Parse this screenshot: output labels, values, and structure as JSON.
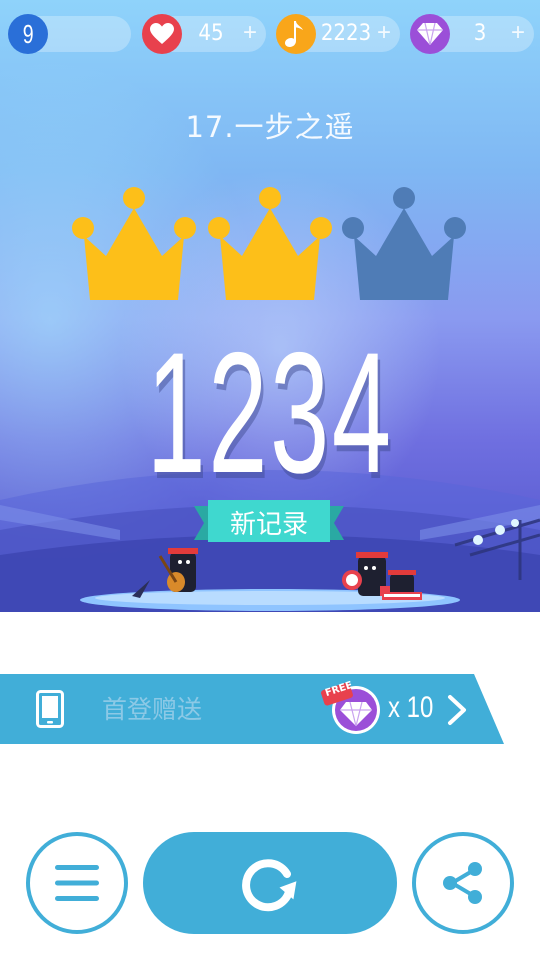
{
  "hud": {
    "level": "9",
    "lives": "45",
    "notes": "2223",
    "diamonds": "3",
    "plus": "+"
  },
  "song": {
    "title": "17.一步之遥"
  },
  "result": {
    "crowns_earned": 2,
    "crowns_total": 3,
    "score": "1234",
    "record_label": "新记录"
  },
  "promo": {
    "label": "首登赠送",
    "badge": "FREE",
    "count": "x 10"
  },
  "colors": {
    "accent": "#41aed8",
    "crown_gold": "#fdbf19",
    "crown_dim": "#4f7cb6",
    "heart": "#e8414d",
    "note": "#f9a61a",
    "diamond": "#9b4fd8",
    "level_badge": "#2a6fd8",
    "ribbon": "#3fd8cf"
  },
  "icons": [
    "heart-icon",
    "music-note-icon",
    "diamond-icon",
    "phone-icon",
    "chevron-right-icon",
    "menu-icon",
    "replay-icon",
    "share-icon"
  ]
}
